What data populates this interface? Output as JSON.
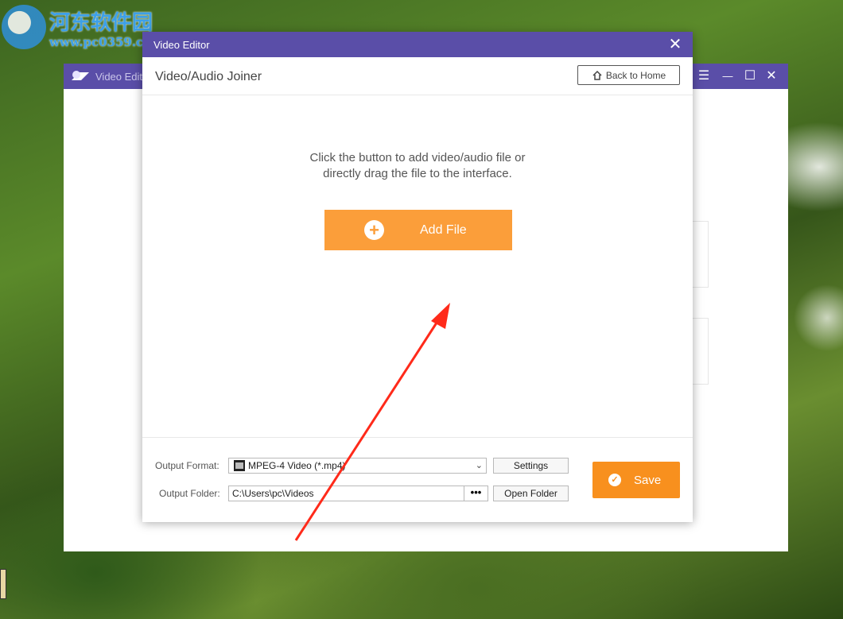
{
  "watermark": {
    "title": "河东软件园",
    "url": "www.pc0359.cn"
  },
  "background_window": {
    "title": "Video Edito",
    "controls": {
      "menu": "☰",
      "minimize": "—",
      "maximize": "☐",
      "close": "✕"
    }
  },
  "dialog": {
    "title": "Video Editor",
    "close_glyph": "✕",
    "heading": "Video/Audio Joiner",
    "back_button": {
      "label": "Back to Home",
      "icon": "home-icon"
    },
    "hint_line1": "Click the button to add video/audio file or",
    "hint_line2": "directly drag the file to the interface.",
    "add_button": {
      "label": "Add File",
      "icon": "plus-circle-icon"
    },
    "output": {
      "format_label": "Output Format:",
      "format_value": "MPEG-4 Video (*.mp4)",
      "settings_label": "Settings",
      "folder_label": "Output Folder:",
      "folder_value": "C:\\Users\\pc\\Videos",
      "browse_label": "•••",
      "open_folder_label": "Open Folder"
    },
    "save_button": {
      "label": "Save",
      "icon": "check-circle-icon"
    }
  },
  "colors": {
    "titlebar": "#5a4ea8",
    "accent_orange": "#fb9e3a",
    "save_orange": "#f8901e",
    "annotation_arrow": "#ff2a1a"
  }
}
